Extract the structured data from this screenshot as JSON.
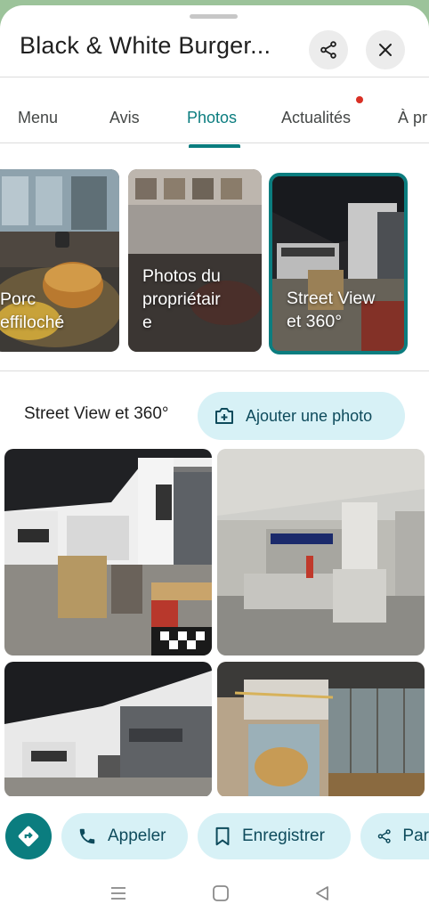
{
  "header": {
    "title": "Black & White Burger...",
    "share_icon": "share-icon",
    "close_icon": "close-icon"
  },
  "tabs": [
    {
      "label": "Menu",
      "active": false
    },
    {
      "label": "Avis",
      "active": false
    },
    {
      "label": "Photos",
      "active": true
    },
    {
      "label": "Actualités",
      "active": false,
      "badge": true
    },
    {
      "label": "À pr",
      "active": false
    }
  ],
  "categories": [
    {
      "label": "Porc\neffiloché",
      "selected": false
    },
    {
      "label": "Photos du\npropriétair\ne",
      "selected": false
    },
    {
      "label": "Street View\net 360°",
      "selected": true
    }
  ],
  "section": {
    "title": "Street View et 360°",
    "add_photo_label": "Ajouter une photo"
  },
  "photos": [
    {
      "description": "restaurant-interior-360"
    },
    {
      "description": "intersport-storefront-360"
    },
    {
      "description": "restaurant-brick-wall-360"
    },
    {
      "description": "restaurant-entrance-360"
    }
  ],
  "actions": {
    "directions_icon": "directions-icon",
    "call_label": "Appeler",
    "save_label": "Enregistrer",
    "share_label": "Par"
  },
  "colors": {
    "accent": "#0b7d7f",
    "pill_bg": "#d7f1f6",
    "badge": "#d93025"
  }
}
